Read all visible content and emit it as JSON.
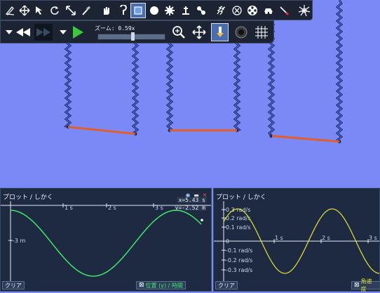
{
  "toolbar": {
    "zoom_label": "ズーム: 0.59x",
    "zoom_level": 0.59,
    "tools_row1": [
      "pen-icon",
      "move-icon",
      "pointer-icon",
      "rotate-icon",
      "scale-icon",
      "knife-icon",
      "hand-icon",
      "hook-icon",
      "box-icon",
      "circle-icon",
      "gear-icon",
      "anchor-icon",
      "chain-icon",
      "spring-icon",
      "x-circle-icon",
      "film-reel-icon",
      "car-icon",
      "lightsaber-icon",
      "spiral-icon"
    ]
  },
  "panel_left": {
    "title": "プロット / しかく",
    "clear_label": "クリア",
    "legend_label": "位置 (y) / 時間",
    "readout_x": "x=5.43 s",
    "readout_y": "y=-2.52 m",
    "y_tick": "-3 m",
    "x_ticks": [
      "1 s",
      "2 s",
      "3 s"
    ],
    "curve_color": "#3ee86a"
  },
  "panel_right": {
    "title": "プロット / しかく",
    "clear_label": "クリア",
    "legend_label": "角速度",
    "y_ticks": [
      "0.3 rad/s",
      "0.2 rad/s",
      "0.1 rad/s",
      "0",
      "-0.1 rad/s",
      "-0.2 rad/s",
      "-0.3 rad/s"
    ],
    "x_ticks": [
      "1 s",
      "2 s",
      "3 s"
    ],
    "curve_color": "#d8d832"
  },
  "colors": {
    "background": "#7a89f5",
    "chain": "#1d2c6a",
    "plank": "#e0602a"
  }
}
